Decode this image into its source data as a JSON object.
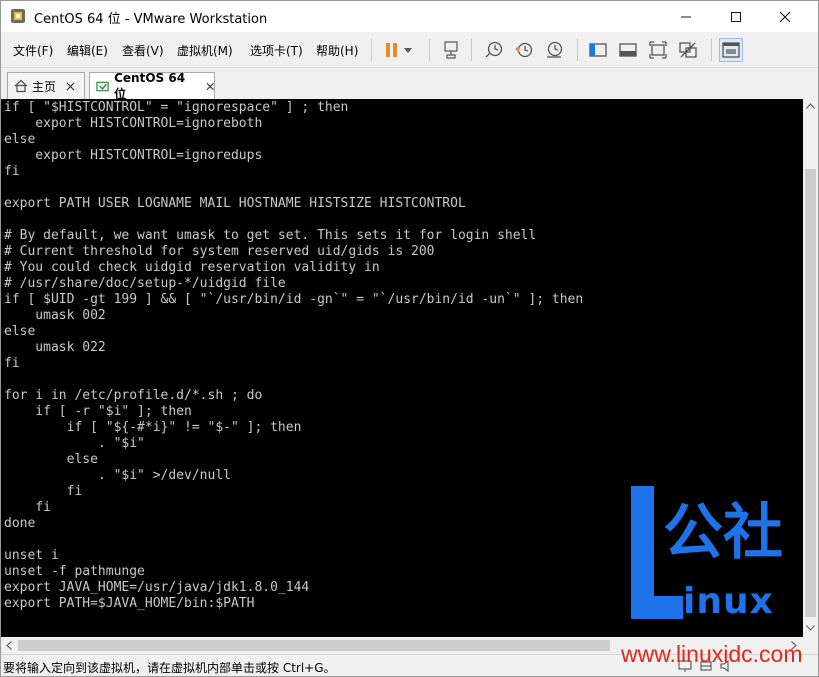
{
  "window": {
    "title": "CentOS 64 位 - VMware Workstation"
  },
  "menu": [
    "文件(F)",
    "编辑(E)",
    "查看(V)",
    "虚拟机(M)",
    "选项卡(T)",
    "帮助(H)"
  ],
  "tabs": [
    {
      "label": "主页"
    },
    {
      "label": "CentOS 64 位"
    }
  ],
  "terminal_lines": [
    "if [ \"$HISTCONTROL\" = \"ignorespace\" ] ; then",
    "    export HISTCONTROL=ignoreboth",
    "else",
    "    export HISTCONTROL=ignoredups",
    "fi",
    "",
    "export PATH USER LOGNAME MAIL HOSTNAME HISTSIZE HISTCONTROL",
    "",
    "# By default, we want umask to get set. This sets it for login shell",
    "# Current threshold for system reserved uid/gids is 200",
    "# You could check uidgid reservation validity in",
    "# /usr/share/doc/setup-*/uidgid file",
    "if [ $UID -gt 199 ] && [ \"`/usr/bin/id -gn`\" = \"`/usr/bin/id -un`\" ]; then",
    "    umask 002",
    "else",
    "    umask 022",
    "fi",
    "",
    "for i in /etc/profile.d/*.sh ; do",
    "    if [ -r \"$i\" ]; then",
    "        if [ \"${-#*i}\" != \"$-\" ]; then",
    "            . \"$i\"",
    "        else",
    "            . \"$i\" >/dev/null",
    "        fi",
    "    fi",
    "done",
    "",
    "unset i",
    "unset -f pathmunge",
    "export JAVA_HOME=/usr/java/jdk1.8.0_144",
    "export PATH=$JAVA_HOME/bin:$PATH"
  ],
  "status": {
    "text": "要将输入定向到该虚拟机，请在虚拟机内部单击或按 Ctrl+G。"
  },
  "watermark": {
    "brand": "公社",
    "word": "inux",
    "url": "www.linuxidc.com"
  },
  "colors": {
    "terminal_bg": "#000000",
    "terminal_fg": "#c8c8c8",
    "pause_icon": "#e8892e",
    "watermark_blue": "#1e73e8",
    "watermark_red": "#e0281e"
  }
}
